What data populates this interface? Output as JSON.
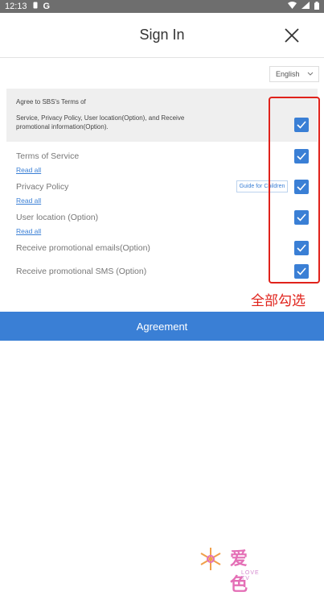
{
  "status_bar": {
    "time": "12:13",
    "app_letter": "G"
  },
  "header": {
    "title": "Sign In"
  },
  "language": {
    "selected": "English"
  },
  "agree_all": {
    "line1": "Agree to SBS's Terms of",
    "line2": "Service, Privacy Policy, User location(Option), and Receive promotional information(Option).",
    "checked": true
  },
  "items": [
    {
      "label": "Terms of Service",
      "read_all": "Read all",
      "checked": true
    },
    {
      "label": "Privacy Policy",
      "read_all": "Read all",
      "guide": "Guide for Children",
      "checked": true
    },
    {
      "label": "User location (Option)",
      "read_all": "Read all",
      "checked": true
    },
    {
      "label": "Receive promotional emails(Option)",
      "checked": true
    },
    {
      "label": "Receive promotional SMS (Option)",
      "checked": true
    }
  ],
  "annotation": "全部勾选",
  "button": {
    "label": "Agreement"
  },
  "watermark": {
    "text": "爱色",
    "sub": "LOVE TV"
  },
  "colors": {
    "accent": "#3a7fd5",
    "annotation": "#e0221b",
    "status_bar": "#6e6e6e"
  }
}
